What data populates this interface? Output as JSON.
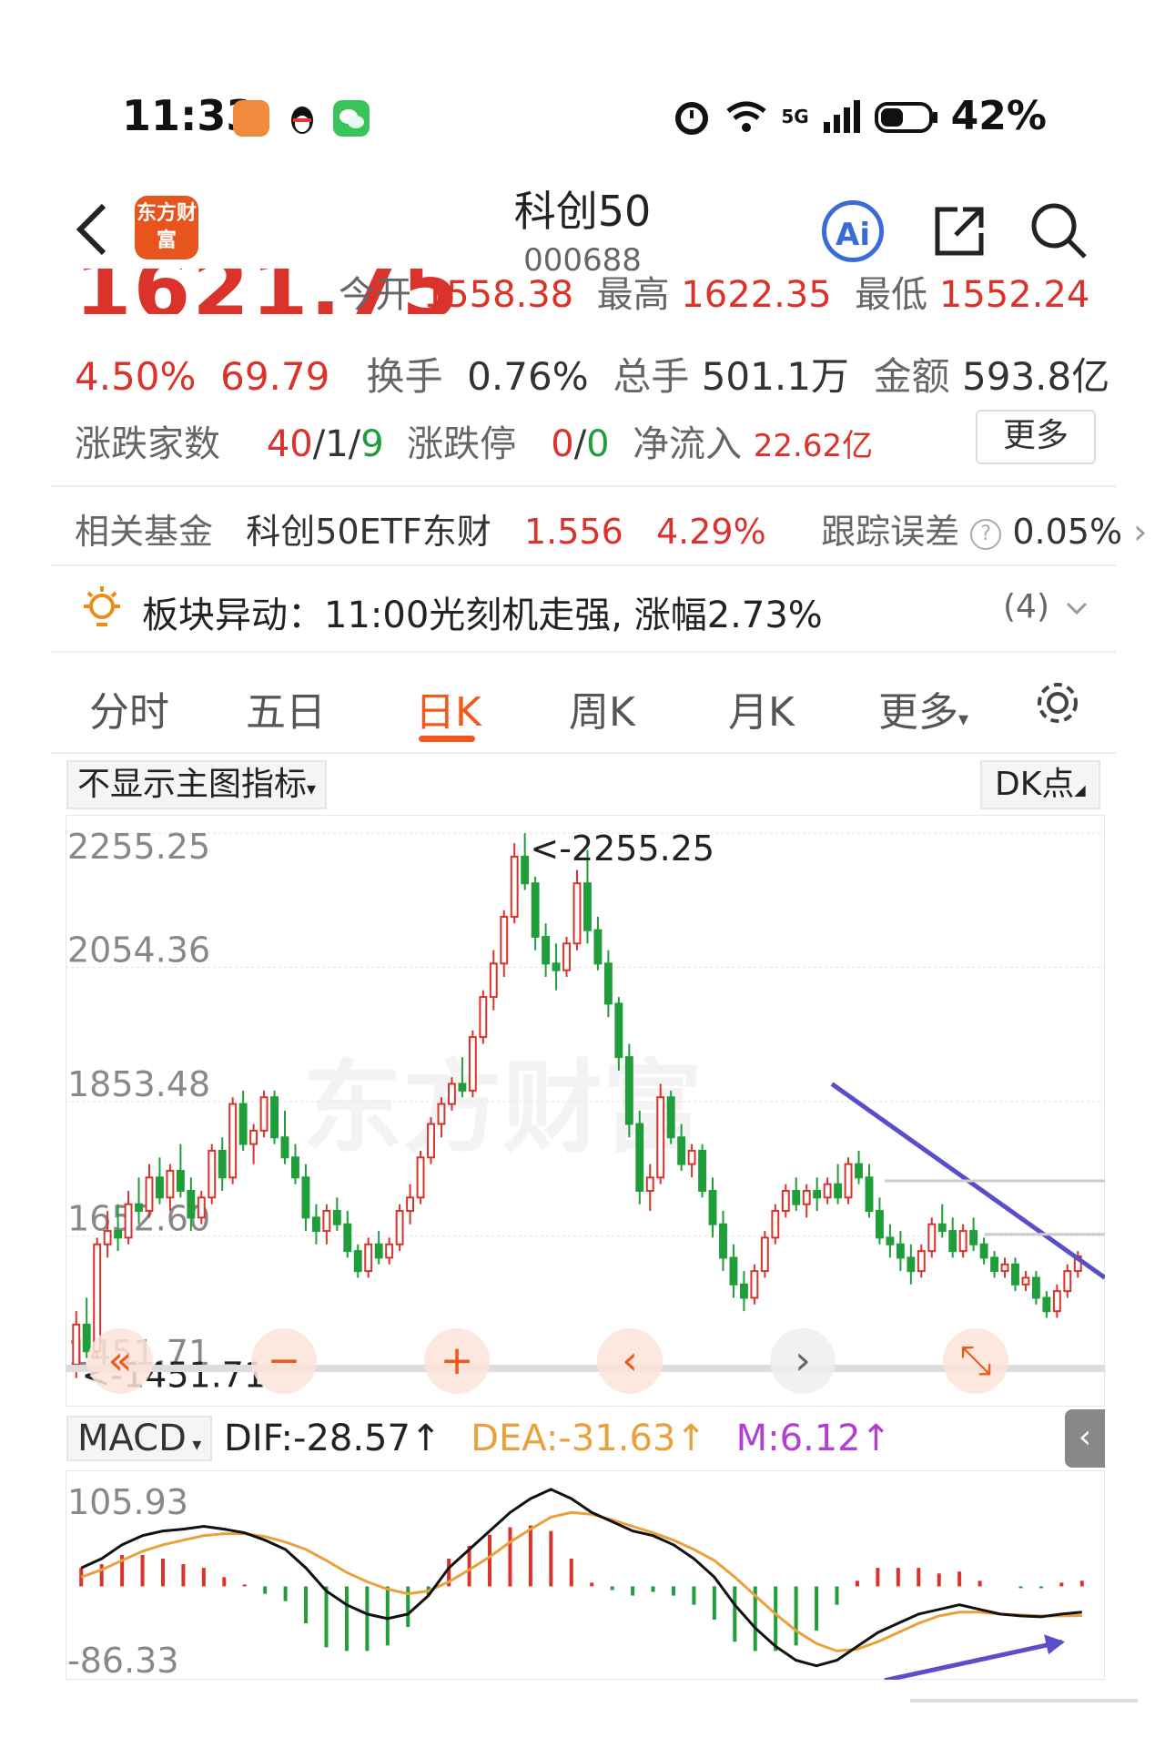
{
  "status_bar": {
    "time": "11:33",
    "network": "5G",
    "battery": "42%"
  },
  "header": {
    "logo_text": "东方财富",
    "title": "科创50",
    "code": "000688",
    "ai_label": "Ai"
  },
  "quote": {
    "price": "1621.75",
    "open_label": "今开",
    "open": "1558.38",
    "high_label": "最高",
    "high": "1622.35",
    "low_label": "最低",
    "low": "1552.24",
    "change_pct": "4.50%",
    "change": "69.79",
    "turnover_label": "换手",
    "turnover": "0.76%",
    "volume_label": "总手",
    "volume": "501.1万",
    "amount_label": "金额",
    "amount": "593.8亿",
    "breadth_label": "涨跌家数",
    "breadth_up": "40",
    "breadth_flat": "1",
    "breadth_down": "9",
    "limit_label": "涨跌停",
    "limit_up": "0",
    "limit_down": "0",
    "inflow_label": "净流入",
    "inflow": "22.62亿",
    "more_label": "更多"
  },
  "fund": {
    "label": "相关基金",
    "name": "科创50ETF东财",
    "price": "1.556",
    "pct": "4.29%",
    "error_label": "跟踪误差",
    "error": "0.05%"
  },
  "alert": {
    "text": "板块异动：11:00光刻机走强, 涨幅2.73%",
    "count": "(4)"
  },
  "tabs": [
    "分时",
    "五日",
    "日K",
    "周K",
    "月K",
    "更多"
  ],
  "active_tab": "日K",
  "indicator_select": "不显示主图指标",
  "dk_label": "DK点",
  "macd": {
    "name": "MACD",
    "dif": "DIF:-28.57↑",
    "dea": "DEA:-31.63↑",
    "m": "M:6.12↑"
  },
  "colors": {
    "up": "#d9332b",
    "down": "#1f9e3a",
    "accent": "#ef5a1c",
    "dea": "#e8a13c",
    "m": "#b33fd1",
    "trend": "#5b4fc9"
  },
  "chart_data": [
    {
      "type": "candlestick",
      "y_ticks": [
        "2255.25",
        "2054.36",
        "1853.48",
        "1652.60",
        "1451.71"
      ],
      "ylim": [
        1451.71,
        2255.25
      ],
      "annotations": [
        "<-2255.25",
        "<-1451.71"
      ],
      "watermark": "东方财富",
      "ohlc": [
        [
          1460,
          1540,
          1440,
          1520
        ],
        [
          1520,
          1560,
          1470,
          1480
        ],
        [
          1480,
          1650,
          1470,
          1640
        ],
        [
          1640,
          1690,
          1620,
          1660
        ],
        [
          1660,
          1700,
          1630,
          1650
        ],
        [
          1650,
          1720,
          1640,
          1700
        ],
        [
          1700,
          1740,
          1670,
          1690
        ],
        [
          1690,
          1760,
          1680,
          1740
        ],
        [
          1740,
          1770,
          1700,
          1710
        ],
        [
          1710,
          1760,
          1690,
          1750
        ],
        [
          1750,
          1790,
          1710,
          1720
        ],
        [
          1720,
          1740,
          1660,
          1680
        ],
        [
          1680,
          1720,
          1670,
          1710
        ],
        [
          1710,
          1790,
          1700,
          1780
        ],
        [
          1780,
          1800,
          1720,
          1740
        ],
        [
          1740,
          1860,
          1730,
          1850
        ],
        [
          1850,
          1870,
          1780,
          1790
        ],
        [
          1790,
          1820,
          1760,
          1810
        ],
        [
          1810,
          1870,
          1800,
          1860
        ],
        [
          1860,
          1870,
          1790,
          1800
        ],
        [
          1800,
          1840,
          1760,
          1770
        ],
        [
          1770,
          1790,
          1730,
          1740
        ],
        [
          1740,
          1760,
          1660,
          1680
        ],
        [
          1680,
          1700,
          1640,
          1660
        ],
        [
          1660,
          1700,
          1640,
          1690
        ],
        [
          1690,
          1710,
          1660,
          1670
        ],
        [
          1670,
          1690,
          1620,
          1630
        ],
        [
          1630,
          1640,
          1590,
          1600
        ],
        [
          1600,
          1650,
          1590,
          1640
        ],
        [
          1640,
          1660,
          1610,
          1620
        ],
        [
          1620,
          1650,
          1610,
          1640
        ],
        [
          1640,
          1700,
          1630,
          1690
        ],
        [
          1690,
          1730,
          1670,
          1710
        ],
        [
          1710,
          1780,
          1700,
          1770
        ],
        [
          1770,
          1830,
          1760,
          1820
        ],
        [
          1820,
          1860,
          1800,
          1850
        ],
        [
          1850,
          1890,
          1840,
          1880
        ],
        [
          1880,
          1920,
          1860,
          1870
        ],
        [
          1870,
          1960,
          1860,
          1950
        ],
        [
          1950,
          2020,
          1940,
          2010
        ],
        [
          2010,
          2080,
          1990,
          2060
        ],
        [
          2060,
          2140,
          2040,
          2130
        ],
        [
          2130,
          2240,
          2120,
          2220
        ],
        [
          2220,
          2255,
          2170,
          2180
        ],
        [
          2180,
          2190,
          2080,
          2100
        ],
        [
          2100,
          2120,
          2040,
          2060
        ],
        [
          2060,
          2090,
          2020,
          2050
        ],
        [
          2050,
          2100,
          2040,
          2090
        ],
        [
          2090,
          2200,
          2080,
          2180
        ],
        [
          2180,
          2230,
          2090,
          2110
        ],
        [
          2110,
          2130,
          2050,
          2060
        ],
        [
          2060,
          2080,
          1980,
          2000
        ],
        [
          2000,
          2010,
          1900,
          1920
        ],
        [
          1920,
          1940,
          1800,
          1820
        ],
        [
          1820,
          1840,
          1700,
          1720
        ],
        [
          1720,
          1760,
          1690,
          1740
        ],
        [
          1740,
          1880,
          1730,
          1860
        ],
        [
          1860,
          1870,
          1790,
          1800
        ],
        [
          1800,
          1820,
          1750,
          1760
        ],
        [
          1760,
          1790,
          1740,
          1780
        ],
        [
          1780,
          1790,
          1710,
          1720
        ],
        [
          1720,
          1740,
          1650,
          1670
        ],
        [
          1670,
          1690,
          1600,
          1620
        ],
        [
          1620,
          1640,
          1560,
          1580
        ],
        [
          1580,
          1600,
          1540,
          1560
        ],
        [
          1560,
          1610,
          1550,
          1600
        ],
        [
          1600,
          1660,
          1590,
          1650
        ],
        [
          1650,
          1700,
          1640,
          1690
        ],
        [
          1690,
          1730,
          1680,
          1720
        ],
        [
          1720,
          1740,
          1690,
          1700
        ],
        [
          1700,
          1730,
          1680,
          1720
        ],
        [
          1720,
          1740,
          1690,
          1710
        ],
        [
          1710,
          1740,
          1700,
          1730
        ],
        [
          1730,
          1760,
          1700,
          1710
        ],
        [
          1710,
          1770,
          1700,
          1760
        ],
        [
          1760,
          1780,
          1730,
          1740
        ],
        [
          1740,
          1760,
          1680,
          1690
        ],
        [
          1690,
          1710,
          1640,
          1650
        ],
        [
          1650,
          1670,
          1620,
          1640
        ],
        [
          1640,
          1660,
          1600,
          1620
        ],
        [
          1620,
          1640,
          1580,
          1600
        ],
        [
          1600,
          1640,
          1590,
          1630
        ],
        [
          1630,
          1680,
          1620,
          1670
        ],
        [
          1670,
          1700,
          1650,
          1660
        ],
        [
          1660,
          1680,
          1620,
          1630
        ],
        [
          1630,
          1670,
          1620,
          1660
        ],
        [
          1660,
          1680,
          1630,
          1640
        ],
        [
          1640,
          1650,
          1610,
          1620
        ],
        [
          1620,
          1630,
          1590,
          1600
        ],
        [
          1600,
          1620,
          1590,
          1610
        ],
        [
          1610,
          1620,
          1570,
          1580
        ],
        [
          1580,
          1600,
          1570,
          1590
        ],
        [
          1590,
          1600,
          1550,
          1560
        ],
        [
          1560,
          1570,
          1530,
          1540
        ],
        [
          1540,
          1580,
          1530,
          1570
        ],
        [
          1570,
          1610,
          1560,
          1600
        ],
        [
          1600,
          1630,
          1590,
          1622
        ]
      ]
    },
    {
      "type": "macd",
      "y_ticks": [
        "105.93",
        "-86.33"
      ],
      "ylim": [
        -86.33,
        105.93
      ],
      "dif": [
        20,
        30,
        45,
        55,
        60,
        62,
        65,
        62,
        58,
        50,
        40,
        20,
        -5,
        -20,
        -30,
        -35,
        -30,
        -10,
        20,
        40,
        60,
        80,
        95,
        105,
        95,
        80,
        70,
        60,
        55,
        45,
        30,
        10,
        -20,
        -45,
        -65,
        -80,
        -86,
        -80,
        -65,
        -50,
        -40,
        -30,
        -25,
        -20,
        -25,
        -30,
        -32,
        -33,
        -30,
        -28
      ],
      "dea": [
        10,
        18,
        28,
        38,
        45,
        50,
        55,
        57,
        57,
        54,
        48,
        40,
        28,
        15,
        5,
        -3,
        -8,
        -5,
        5,
        18,
        32,
        48,
        62,
        75,
        80,
        78,
        72,
        65,
        58,
        50,
        40,
        28,
        10,
        -10,
        -30,
        -48,
        -62,
        -70,
        -68,
        -60,
        -50,
        -40,
        -32,
        -28,
        -28,
        -30,
        -31,
        -32,
        -32,
        -31.63
      ],
      "m": [
        20,
        24,
        34,
        34,
        30,
        24,
        20,
        10,
        2,
        -8,
        -16,
        -40,
        -66,
        -70,
        -70,
        -64,
        -44,
        -10,
        30,
        44,
        56,
        64,
        66,
        60,
        30,
        4,
        -4,
        -10,
        -6,
        -10,
        -20,
        -36,
        -60,
        -70,
        -70,
        -64,
        -48,
        -20,
        6,
        20,
        20,
        20,
        14,
        16,
        6,
        0,
        -2,
        -2,
        4,
        6.12
      ]
    }
  ]
}
